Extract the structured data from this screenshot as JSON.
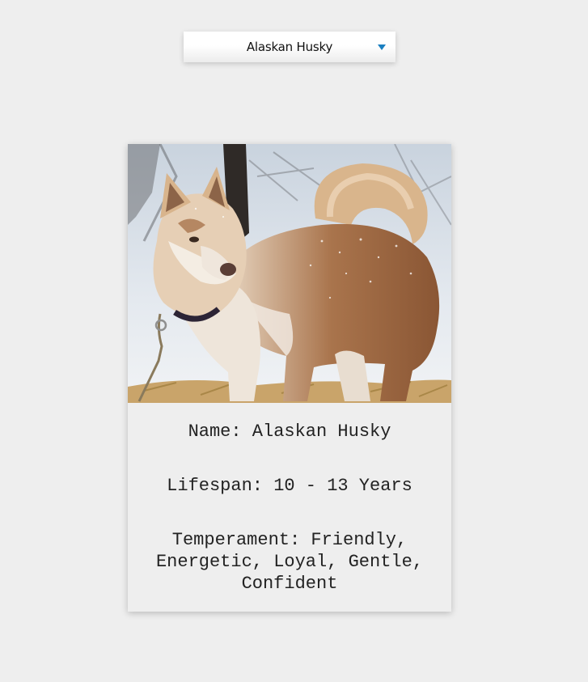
{
  "selector": {
    "selected_value": "Alaskan Husky",
    "caret_color": "#1a7fc1"
  },
  "card": {
    "image_subject": "dog-photo",
    "name_line": "Name: Alaskan Husky",
    "lifespan_line": "Lifespan: 10 - 13 Years",
    "temperament_line": "Temperament: Friendly, Energetic, Loyal, Gentle, Confident"
  }
}
